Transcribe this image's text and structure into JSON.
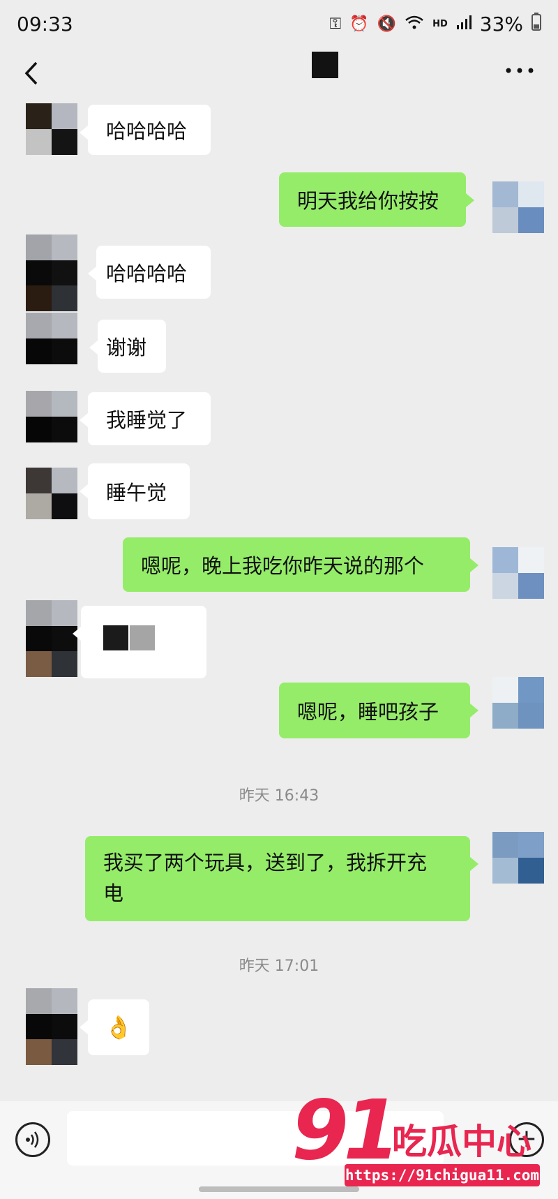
{
  "status_bar": {
    "time": "09:33",
    "battery": "33%",
    "icons": [
      "key-icon",
      "alarm-icon",
      "mute-icon",
      "wifi-icon",
      "hd-icon",
      "signal-icon",
      "battery-icon"
    ],
    "hd_label": "HD"
  },
  "header": {
    "back_icon": "chevron-left-icon",
    "more_label": "…"
  },
  "messages": [
    {
      "side": "in",
      "text": "哈哈哈哈"
    },
    {
      "side": "out",
      "text": "明天我给你按按"
    },
    {
      "side": "in",
      "text": "哈哈哈哈"
    },
    {
      "side": "in",
      "text": "谢谢"
    },
    {
      "side": "in",
      "text": "我睡觉了"
    },
    {
      "side": "in",
      "text": "睡午觉"
    },
    {
      "side": "out",
      "text": "嗯呢，晚上我吃你昨天说的那个"
    },
    {
      "side": "in",
      "text": ""
    },
    {
      "side": "out",
      "text": "嗯呢，睡吧孩子"
    },
    {
      "side": "out",
      "text_line1": "我买了两个玩具，送到了，我拆开充",
      "text_line2": "电"
    },
    {
      "side": "in",
      "text": "👌"
    }
  ],
  "timestamps": [
    "昨天 16:43",
    "昨天 17:01"
  ],
  "input_bar": {
    "voice_icon": "voice-icon",
    "plus_label": "+"
  },
  "watermark": {
    "number": "91",
    "brand": "吃瓜中心",
    "url": "https://91chigua11.com"
  },
  "colors": {
    "outgoing_bubble": "#95ec69",
    "incoming_bubble": "#ffffff",
    "background": "#ededed",
    "watermark": "#e8264f"
  }
}
